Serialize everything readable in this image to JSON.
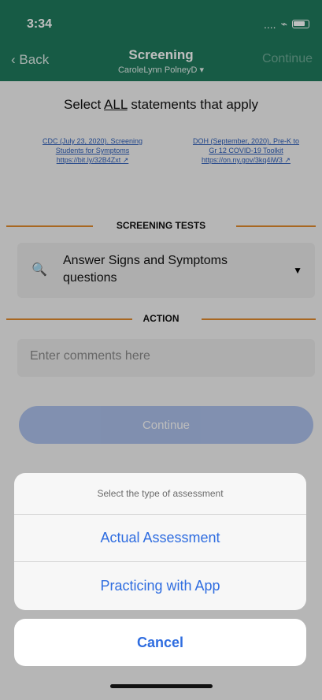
{
  "status_bar": {
    "time": "3:34",
    "signal": "....",
    "wifi": "wifi",
    "battery": "battery"
  },
  "header": {
    "back_label": "Back",
    "title": "Screening",
    "subtitle": "CaroleLynn PolneyD",
    "continue_label": "Continue"
  },
  "content": {
    "instruction_prefix": "Select ",
    "instruction_emphasis": "ALL",
    "instruction_suffix": " statements that apply",
    "refs": [
      {
        "text": "CDC (July 23, 2020). Screening Students for Symptoms https://bit.ly/32B4Zxt ↗"
      },
      {
        "text": "DOH (September, 2020). Pre-K to Gr 12 COVID-19 Toolkit https://on.ny.gov/3kq4iW3 ↗"
      }
    ],
    "screening_tests_label": "SCREENING TESTS",
    "dropdown_text": "Answer Signs and Symptoms questions",
    "action_label": "ACTION",
    "comments_placeholder": "Enter comments here",
    "continue_button": "Continue"
  },
  "sheet": {
    "heading": "Select the type of assessment",
    "options": [
      "Actual Assessment",
      "Practicing with App"
    ],
    "cancel_label": "Cancel"
  },
  "colors": {
    "header": "#1f7a5c",
    "accent_orange": "#e08a2c",
    "link_blue": "#2f6de0"
  }
}
